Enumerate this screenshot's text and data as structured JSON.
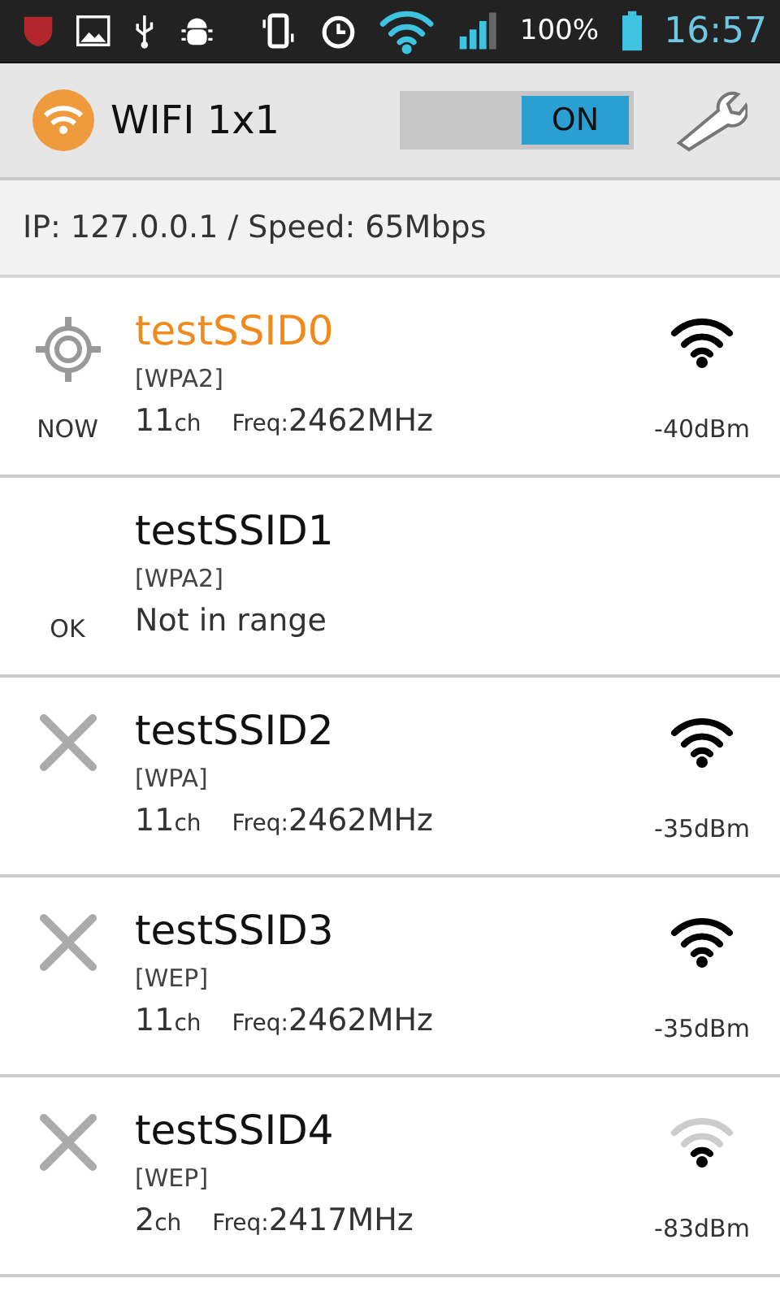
{
  "status_bar": {
    "battery": "100%",
    "time": "16:57"
  },
  "header": {
    "title": "WIFI 1x1",
    "switch": {
      "label": "ON",
      "on": true
    }
  },
  "info": "IP: 127.0.0.1 / Speed: 65Mbps",
  "networks": [
    {
      "name": "testSSID0",
      "selected": true,
      "security": "[WPA2]",
      "connected": true,
      "failed": false,
      "status_label": "NOW",
      "kind": "in_range",
      "channel": "11",
      "channel_unit": "ch",
      "freq_label": "Freq:",
      "freq": "2462MHz",
      "weak": false,
      "dbm": "-40dBm"
    },
    {
      "name": "testSSID1",
      "selected": false,
      "security": "[WPA2]",
      "connected": false,
      "failed": false,
      "status_label": "OK",
      "kind": "out_of_range",
      "note": "Not in range"
    },
    {
      "name": "testSSID2",
      "selected": false,
      "security": "[WPA]",
      "connected": false,
      "failed": true,
      "kind": "in_range",
      "channel": "11",
      "channel_unit": "ch",
      "freq_label": "Freq:",
      "freq": "2462MHz",
      "weak": false,
      "dbm": "-35dBm"
    },
    {
      "name": "testSSID3",
      "selected": false,
      "security": "[WEP]",
      "connected": false,
      "failed": true,
      "kind": "in_range",
      "channel": "11",
      "channel_unit": "ch",
      "freq_label": "Freq:",
      "freq": "2462MHz",
      "weak": false,
      "dbm": "-35dBm"
    },
    {
      "name": "testSSID4",
      "selected": false,
      "security": "[WEP]",
      "connected": false,
      "failed": true,
      "kind": "in_range",
      "channel": "2",
      "channel_unit": "ch",
      "freq_label": "Freq:",
      "freq": "2417MHz",
      "weak": true,
      "dbm": "-83dBm"
    }
  ]
}
